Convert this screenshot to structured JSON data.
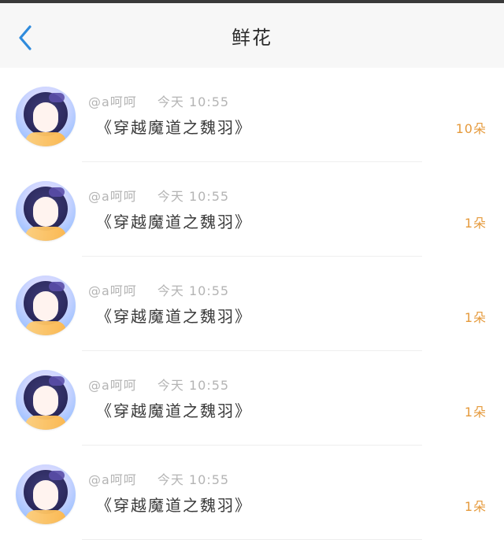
{
  "header": {
    "title": "鲜花",
    "back_icon": "chevron-left-icon",
    "accent_color": "#2f8bdc"
  },
  "list": {
    "items": [
      {
        "user": "@a呵呵",
        "time": "今天 10:55",
        "title": "《穿越魔道之魏羽》",
        "count": "10朵"
      },
      {
        "user": "@a呵呵",
        "time": "今天 10:55",
        "title": "《穿越魔道之魏羽》",
        "count": "1朵"
      },
      {
        "user": "@a呵呵",
        "time": "今天 10:55",
        "title": "《穿越魔道之魏羽》",
        "count": "1朵"
      },
      {
        "user": "@a呵呵",
        "time": "今天 10:55",
        "title": "《穿越魔道之魏羽》",
        "count": "1朵"
      },
      {
        "user": "@a呵呵",
        "time": "今天 10:55",
        "title": "《穿越魔道之魏羽》",
        "count": "1朵"
      }
    ]
  }
}
